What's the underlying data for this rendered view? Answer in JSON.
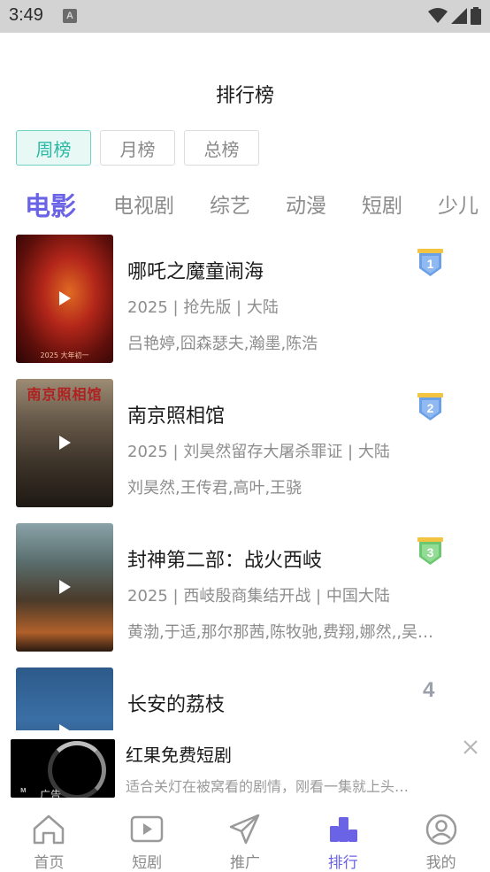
{
  "status_bar": {
    "time": "3:49",
    "notification_icon": "A"
  },
  "page": {
    "title": "排行榜"
  },
  "period_tabs": [
    {
      "label": "周榜",
      "active": true
    },
    {
      "label": "月榜",
      "active": false
    },
    {
      "label": "总榜",
      "active": false
    }
  ],
  "category_tabs": [
    {
      "label": "电影",
      "active": true
    },
    {
      "label": "电视剧",
      "active": false
    },
    {
      "label": "综艺",
      "active": false
    },
    {
      "label": "动漫",
      "active": false
    },
    {
      "label": "短剧",
      "active": false
    },
    {
      "label": "少儿",
      "active": false
    }
  ],
  "rankings": [
    {
      "rank": "1",
      "title": "哪吒之魔童闹海",
      "meta": "2025 | 抢先版 | 大陆",
      "cast": "吕艳婷,囧森瑟夫,瀚墨,陈浩",
      "badge_color": "#6aa0e8",
      "poster_text": "",
      "poster_caption": "2025 大年初一"
    },
    {
      "rank": "2",
      "title": "南京照相馆",
      "meta": "2025 | 刘昊然留存大屠杀罪证 | 大陆",
      "cast": "刘昊然,王传君,高叶,王骁",
      "badge_color": "#6aa0e8",
      "poster_text": "南京照相馆",
      "poster_caption": ""
    },
    {
      "rank": "3",
      "title": "封神第二部：战火西岐",
      "meta": "2025 | 西岐殷商集结开战 | 中国大陆",
      "cast": "黄渤,于适,那尔那茜,陈牧驰,费翔,娜然,,吴…",
      "badge_color": "#6cc870",
      "poster_text": "",
      "poster_caption": ""
    },
    {
      "rank": "4",
      "title": "长安的荔枝",
      "meta": "",
      "cast": "",
      "badge_color": "",
      "poster_text": "",
      "poster_caption": ""
    }
  ],
  "ad": {
    "title": "红果免费短剧",
    "description": "适合关灯在被窝看的剧情，刚看一集就上头…",
    "label": "广告",
    "logo_text": "ᴍ"
  },
  "bottom_nav": [
    {
      "label": "首页",
      "icon": "home-icon",
      "active": false
    },
    {
      "label": "短剧",
      "icon": "play-box-icon",
      "active": false
    },
    {
      "label": "推广",
      "icon": "paper-plane-icon",
      "active": false
    },
    {
      "label": "排行",
      "icon": "ranking-icon",
      "active": true
    },
    {
      "label": "我的",
      "icon": "user-icon",
      "active": false
    }
  ],
  "colors": {
    "accent": "#6b63e6",
    "period_active": "#2bb8a5",
    "text_secondary": "#8d8d8d"
  }
}
